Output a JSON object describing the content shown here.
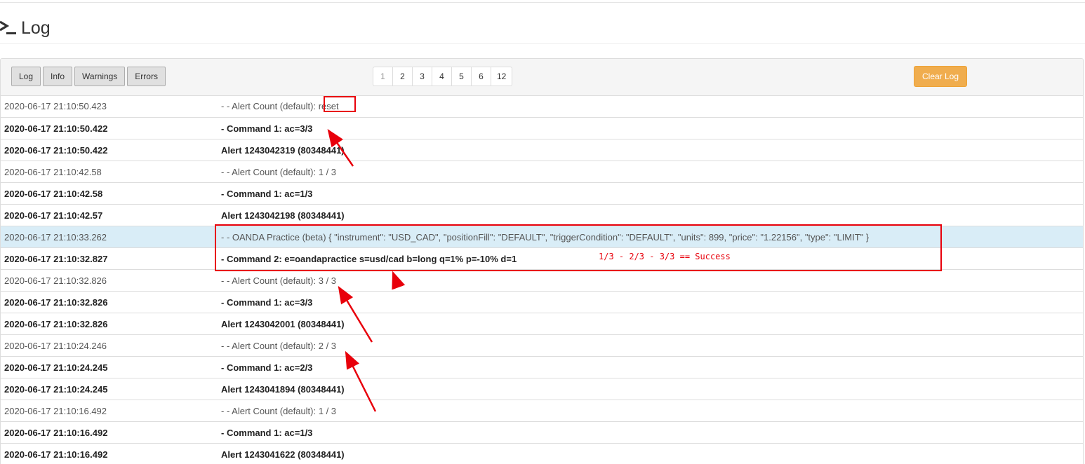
{
  "header": {
    "title": "Log",
    "icon": "terminal-prompt-icon"
  },
  "toolbar": {
    "filters": [
      "Log",
      "Info",
      "Warnings",
      "Errors"
    ],
    "pages": [
      "1",
      "2",
      "3",
      "4",
      "5",
      "6",
      "12"
    ],
    "active_page": "1",
    "clear_label": "Clear Log"
  },
  "rows": [
    {
      "ts": "2020-06-17 21:10:50.423",
      "msg": "- - Alert Count (default): reset",
      "style": "info"
    },
    {
      "ts": "2020-06-17 21:10:50.422",
      "msg": "- Command 1: ac=3/3",
      "style": "cmd"
    },
    {
      "ts": "2020-06-17 21:10:50.422",
      "msg": "Alert 1243042319 (80348441)",
      "style": "cmd"
    },
    {
      "ts": "2020-06-17 21:10:42.58",
      "msg": "- - Alert Count (default): 1 / 3",
      "style": "info"
    },
    {
      "ts": "2020-06-17 21:10:42.58",
      "msg": "- Command 1: ac=1/3",
      "style": "cmd"
    },
    {
      "ts": "2020-06-17 21:10:42.57",
      "msg": "Alert 1243042198 (80348441)",
      "style": "cmd"
    },
    {
      "ts": "2020-06-17 21:10:33.262",
      "msg": "- - OANDA Practice (beta) { \"instrument\": \"USD_CAD\", \"positionFill\": \"DEFAULT\", \"triggerCondition\": \"DEFAULT\", \"units\": 899, \"price\": \"1.22156\", \"type\": \"LIMIT\" }",
      "style": "info highlight"
    },
    {
      "ts": "2020-06-17 21:10:32.827",
      "msg": "- Command 2: e=oandapractice s=usd/cad b=long q=1% p=-10% d=1",
      "style": "cmd"
    },
    {
      "ts": "2020-06-17 21:10:32.826",
      "msg": "- - Alert Count (default): 3 / 3",
      "style": "info"
    },
    {
      "ts": "2020-06-17 21:10:32.826",
      "msg": "- Command 1: ac=3/3",
      "style": "cmd"
    },
    {
      "ts": "2020-06-17 21:10:32.826",
      "msg": "Alert 1243042001 (80348441)",
      "style": "cmd"
    },
    {
      "ts": "2020-06-17 21:10:24.246",
      "msg": "- - Alert Count (default): 2 / 3",
      "style": "info"
    },
    {
      "ts": "2020-06-17 21:10:24.245",
      "msg": "- Command 1: ac=2/3",
      "style": "cmd"
    },
    {
      "ts": "2020-06-17 21:10:24.245",
      "msg": "Alert 1243041894 (80348441)",
      "style": "cmd"
    },
    {
      "ts": "2020-06-17 21:10:16.492",
      "msg": "- - Alert Count (default): 1 / 3",
      "style": "info"
    },
    {
      "ts": "2020-06-17 21:10:16.492",
      "msg": "- Command 1: ac=1/3",
      "style": "cmd"
    },
    {
      "ts": "2020-06-17 21:10:16.492",
      "msg": "Alert 1243041622 (80348441)",
      "style": "cmd"
    }
  ],
  "annotation": {
    "text": "1/3 - 2/3 - 3/3 == Success",
    "color": "#e8000b"
  },
  "colors": {
    "highlight_row": "#d9edf7",
    "clear_button": "#f0ad4e",
    "annotation": "#e8000b"
  }
}
